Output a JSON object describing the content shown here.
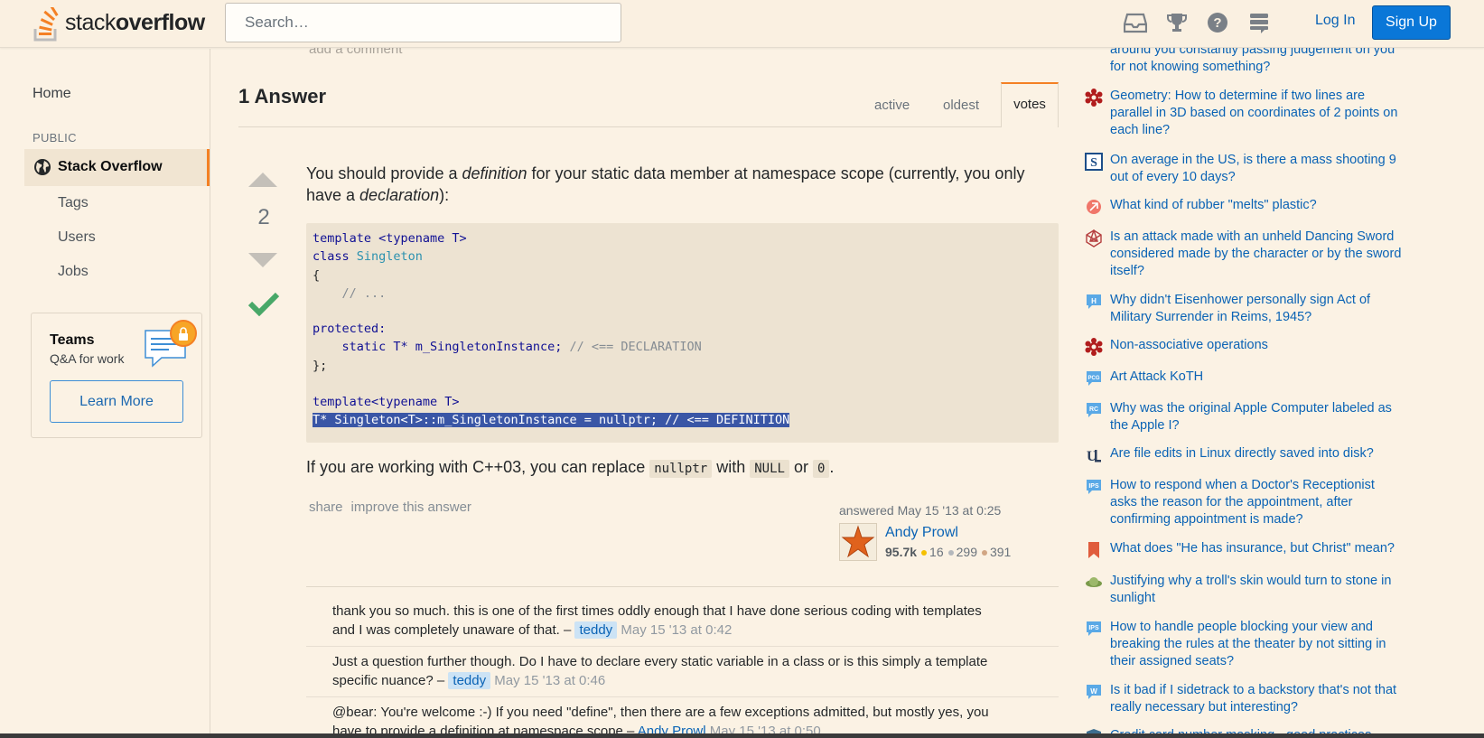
{
  "header": {
    "logo_text_regular": "stack",
    "logo_text_bold": "overflow",
    "search_placeholder": "Search…",
    "icons": [
      "inbox-icon",
      "achievements-icon",
      "help-icon",
      "stackexchange-icon"
    ],
    "login_label": "Log In",
    "signup_label": "Sign Up"
  },
  "sidebar": {
    "home": "Home",
    "public_label": "PUBLIC",
    "stack_overflow": "Stack Overflow",
    "items": [
      "Tags",
      "Users",
      "Jobs"
    ],
    "teams_title": "Teams",
    "teams_subtitle": "Q&A for work",
    "learn_more": "Learn More"
  },
  "main": {
    "faded_top": "add a comment",
    "answers_heading": "1 Answer",
    "tabs": [
      "active",
      "oldest",
      "votes"
    ],
    "vote_count": "2",
    "answer_intro": {
      "t1": "You should provide a ",
      "em1": "definition",
      "t2": " for your static data member at namespace scope (currently, you only have a ",
      "em2": "declaration",
      "t3": "):"
    },
    "code": {
      "l1a": "template <typename T>",
      "l2a": "class ",
      "l2b": "Singleton",
      "l3": "{",
      "l4": "    // ...",
      "l6": "protected:",
      "l7a": "    static T* m_SingletonInstance; ",
      "l7b": "// <== DECLARATION",
      "l8": "};",
      "l10": "template<typename T>",
      "l11": "T* Singleton<T>::m_SingletonInstance = nullptr; // <== DEFINITION"
    },
    "p2": {
      "t1": "If you are working with C++03, you can replace ",
      "c1": "nullptr",
      "t2": " with ",
      "c2": "NULL",
      "t3": " or ",
      "c3": "0",
      "t4": "."
    },
    "post_menu": [
      "share",
      "improve this answer"
    ],
    "answered_label": "answered May 15 '13 at 0:25",
    "user": {
      "name": "Andy Prowl",
      "rep": "95.7k",
      "gold": "16",
      "silver": "299",
      "bronze": "391"
    },
    "comments": [
      {
        "text1": "thank you so much. this is one of the first times oddly enough that I have done serious coding with templates",
        "text2": "and I was completely unaware of that. – ",
        "user": "teddy",
        "date": "May 15 '13 at 0:42"
      },
      {
        "text1": "Just a question further though. Do I have to declare every static variable in a class or is this simply a template",
        "text2": "specific nuance? – ",
        "user": "teddy",
        "date": "May 15 '13 at 0:46"
      },
      {
        "text1": "@bear: You're welcome :-) If you need \"define\", then there are a few exceptions admitted, but mostly yes, you",
        "text2": "have to provide a definition at namespace scope – ",
        "user": "Andy Prowl",
        "date": "May 15 '13 at 0:50"
      }
    ]
  },
  "hot_network": [
    {
      "icon": "partial-question-icon",
      "l1": "around you constantly passing judgement on you",
      "l2": "for not knowing something?"
    },
    {
      "icon": "math-icon",
      "l1": "Geometry: How to determine if two lines are",
      "l2": "parallel in 3D based on coordinates of 2 points on",
      "l3": "each line?"
    },
    {
      "icon": "skeptics-icon",
      "l1": "On average in the US, is there a mass shooting 9",
      "l2": "out of every 10 days?"
    },
    {
      "icon": "chemistry-icon",
      "l1": "What kind of rubber \"melts\" plastic?"
    },
    {
      "icon": "rpg-icon",
      "l1": "Is an attack made with an unheld Dancing Sword",
      "l2": "considered made by the character or by the sword",
      "l3": "itself?"
    },
    {
      "icon": "history-icon",
      "l1": "Why didn't Eisenhower personally sign Act of",
      "l2": "Military Surrender in Reims, 1945?"
    },
    {
      "icon": "math-icon",
      "l1": "Non-associative operations"
    },
    {
      "icon": "codegolf-icon",
      "l1": "Art Attack KoTH"
    },
    {
      "icon": "retrocomputing-icon",
      "l1": "Why was the original Apple Computer labeled as",
      "l2": "the Apple I?"
    },
    {
      "icon": "unix-icon",
      "l1": "Are file edits in Linux directly saved into disk?"
    },
    {
      "icon": "interpersonal-icon",
      "l1": "How to respond when a Doctor's Receptionist",
      "l2": "asks the reason for the appointment, after",
      "l3": "confirming appointment is made?"
    },
    {
      "icon": "hermeneutics-icon",
      "l1": "What does \"He has insurance, but Christ\" mean?"
    },
    {
      "icon": "scifi-icon",
      "l1": "Justifying why a troll's skin would turn to stone in",
      "l2": "sunlight"
    },
    {
      "icon": "interpersonal-icon",
      "l1": "How to handle people blocking your view and",
      "l2": "breaking the rules at the theater by not sitting in",
      "l3": "their assigned seats?"
    },
    {
      "icon": "writing-icon",
      "l1": "Is it bad if I sidetrack to a backstory that's not that",
      "l2": "really necessary but interesting?"
    },
    {
      "icon": "security-icon",
      "l1": "Credit card number masking - good practices"
    }
  ],
  "colors": {
    "accent": "#f48024",
    "link": "#0a63b5",
    "signup": "#0a77d8",
    "accepted": "#48a868",
    "background": "#fbf2e4"
  }
}
